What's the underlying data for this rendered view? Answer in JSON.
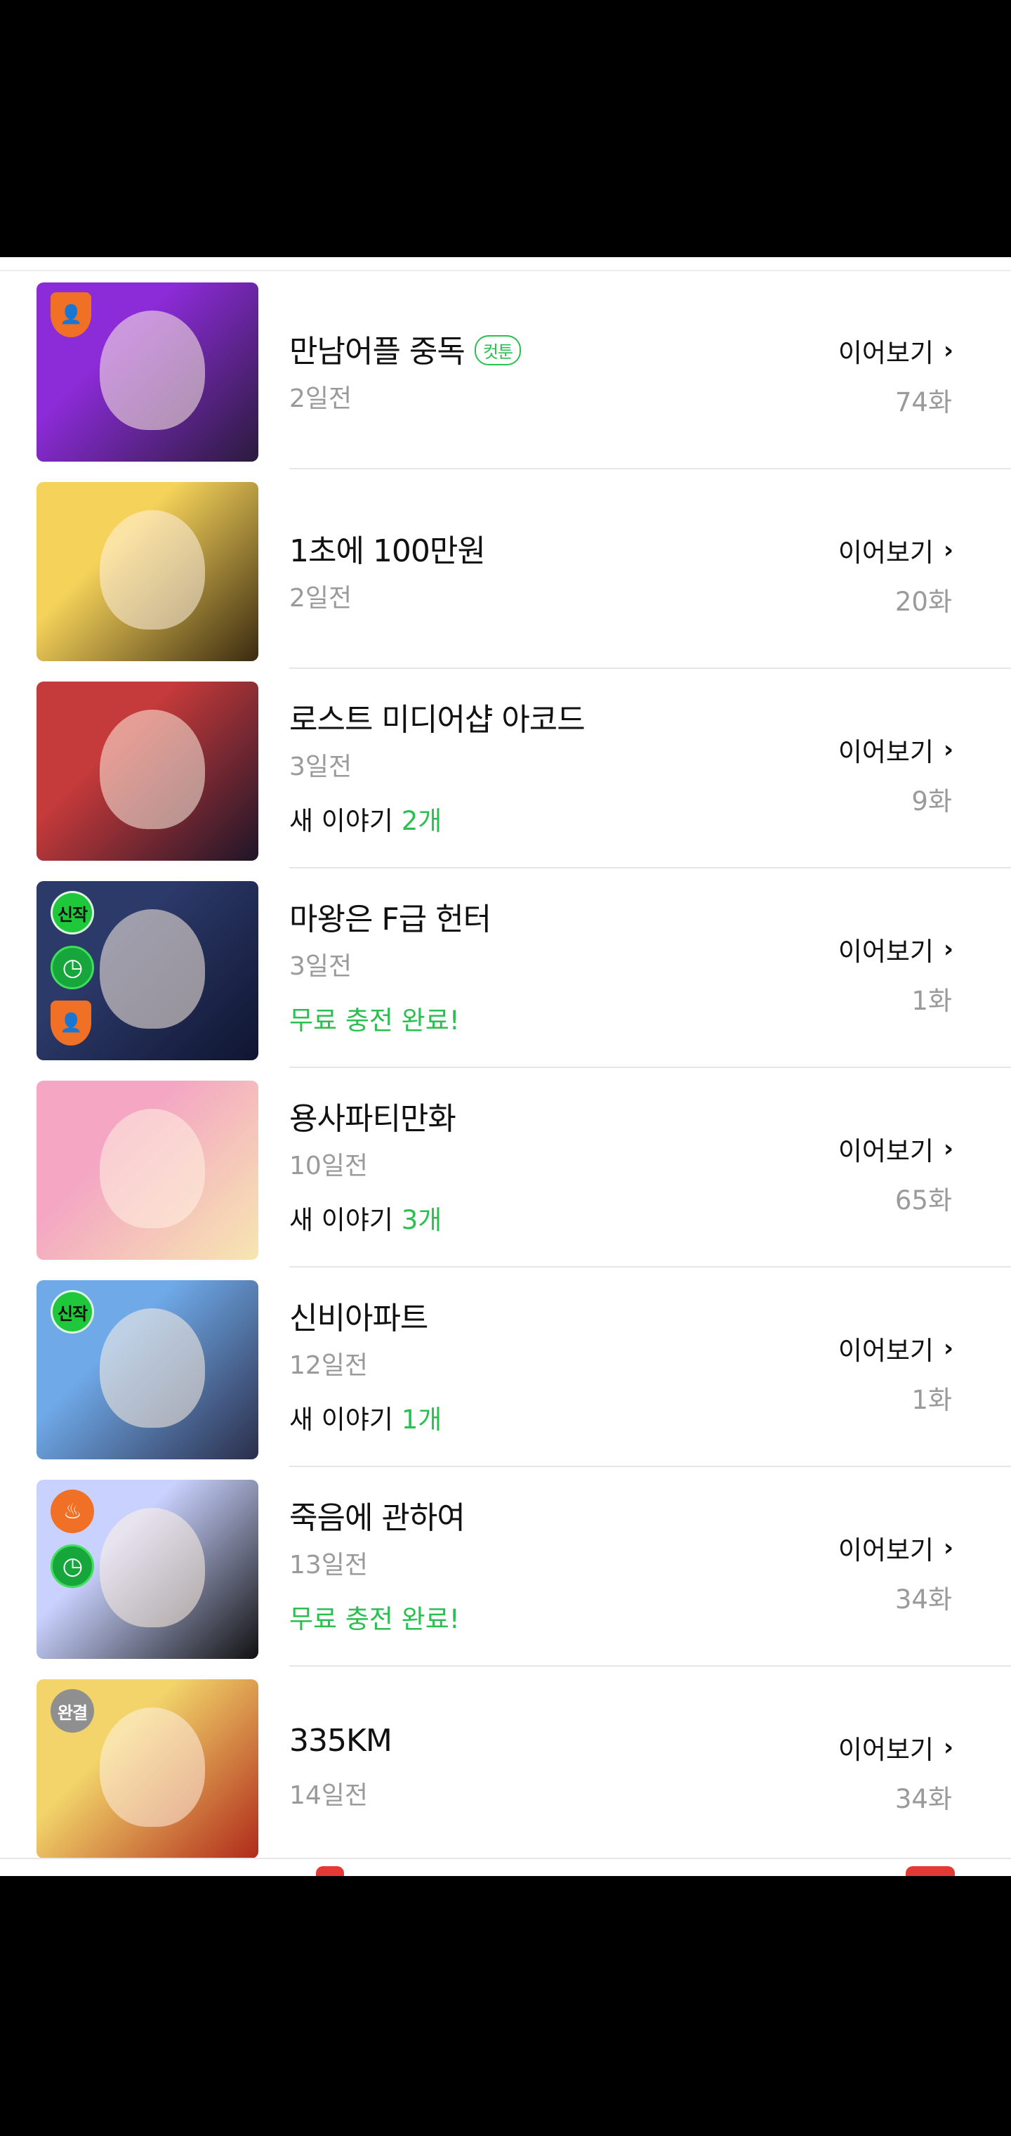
{
  "list": {
    "items": [
      {
        "title": "만남어플 중독",
        "tag": "컷툰",
        "date": "2일전",
        "extra_prefix": "",
        "extra_highlight": "",
        "continue": "이어보기",
        "episode": "74화",
        "badges": [
          "person-icon"
        ],
        "colors": [
          "#8c2bd8",
          "#2a1b3c"
        ]
      },
      {
        "title": "1초에 100만원",
        "tag": "",
        "date": "2일전",
        "extra_prefix": "",
        "extra_highlight": "",
        "continue": "이어보기",
        "episode": "20화",
        "badges": [],
        "colors": [
          "#f5d25a",
          "#3a2a10"
        ]
      },
      {
        "title": "로스트 미디어샵 아코드",
        "tag": "",
        "date": "3일전",
        "extra_prefix": "새 이야기 ",
        "extra_highlight": "2개",
        "continue": "이어보기",
        "episode": "9화",
        "badges": [],
        "colors": [
          "#c53a3a",
          "#1e1528"
        ]
      },
      {
        "title": "마왕은 F급 헌터",
        "tag": "",
        "date": "3일전",
        "extra_prefix": "",
        "extra_highlight": "무료 충전 완료!",
        "continue": "이어보기",
        "episode": "1화",
        "badges": [
          "new-badge",
          "timer-icon",
          "person-icon"
        ],
        "new_label": "신작",
        "colors": [
          "#2c3a6a",
          "#0f1530"
        ]
      },
      {
        "title": "용사파티만화",
        "tag": "",
        "date": "10일전",
        "extra_prefix": "새 이야기 ",
        "extra_highlight": "3개",
        "continue": "이어보기",
        "episode": "65화",
        "badges": [],
        "colors": [
          "#f4a6c3",
          "#f6e6b0"
        ]
      },
      {
        "title": "신비아파트",
        "tag": "",
        "date": "12일전",
        "extra_prefix": "새 이야기 ",
        "extra_highlight": "1개",
        "continue": "이어보기",
        "episode": "1화",
        "badges": [
          "new-badge"
        ],
        "new_label": "신작",
        "colors": [
          "#6fa9e8",
          "#2b2e4a"
        ]
      },
      {
        "title": "죽음에 관하여",
        "tag": "",
        "date": "13일전",
        "extra_prefix": "",
        "extra_highlight": "무료 충전 완료!",
        "continue": "이어보기",
        "episode": "34화",
        "badges": [
          "fire-icon",
          "timer-icon"
        ],
        "colors": [
          "#c9d2ff",
          "#111111"
        ]
      },
      {
        "title": "335KM",
        "tag": "",
        "date": "14일전",
        "extra_prefix": "",
        "extra_highlight": "",
        "continue": "이어보기",
        "episode": "34화",
        "badges": [
          "done-badge"
        ],
        "done_label": "완결",
        "colors": [
          "#f2d46a",
          "#b02a1a"
        ]
      }
    ]
  },
  "colors": {
    "accent": "#2bbf4f",
    "muted": "#9a9a9a",
    "text": "#111111"
  }
}
